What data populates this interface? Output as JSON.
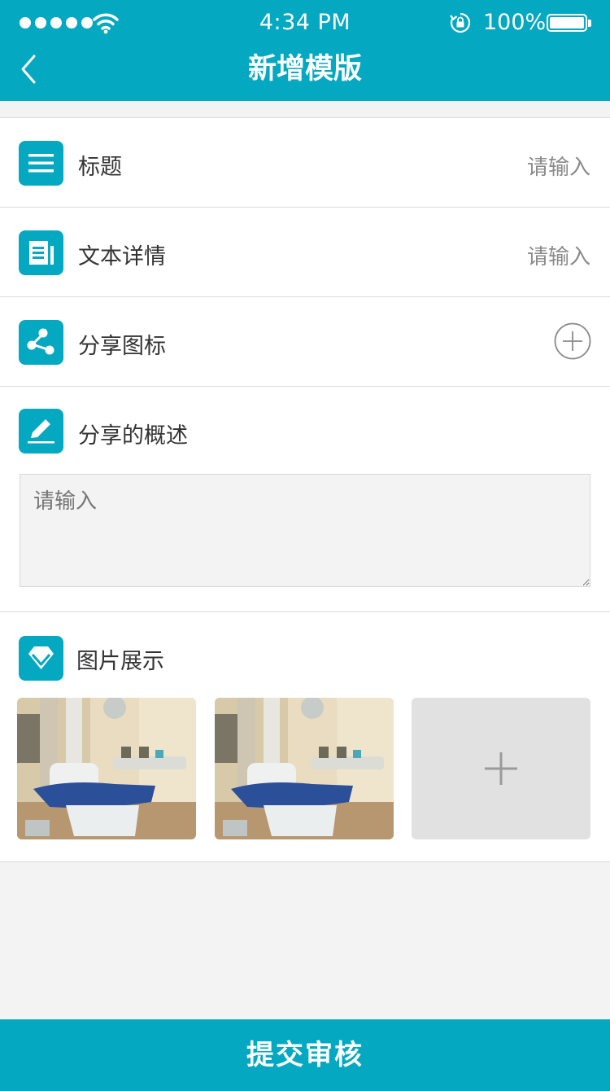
{
  "status_bar": {
    "time": "4:34 PM",
    "battery_percent": "100%",
    "signal_bars": 5
  },
  "nav": {
    "title": "新增模版",
    "back_icon": "chevron-left-icon"
  },
  "form": {
    "title_row": {
      "label": "标题",
      "placeholder": "请输入",
      "icon": "menu-lines-icon"
    },
    "detail_row": {
      "label": "文本详情",
      "placeholder": "请输入",
      "icon": "document-icon"
    },
    "share_icon_row": {
      "label": "分享图标",
      "icon": "share-icon",
      "action_icon": "plus-circle-icon"
    },
    "summary": {
      "label": "分享的概述",
      "placeholder": "请输入",
      "icon": "pencil-icon"
    },
    "photos": {
      "label": "图片展示",
      "icon": "diamond-icon",
      "add_icon": "plus-icon",
      "items": [
        {
          "subject": "dental chair"
        },
        {
          "subject": "dental chair"
        }
      ]
    }
  },
  "submit_label": "提交审核",
  "colors": {
    "accent": "#04a9c1",
    "background": "#f3f3f3",
    "text": "#333333",
    "placeholder": "#8a8a8a"
  }
}
